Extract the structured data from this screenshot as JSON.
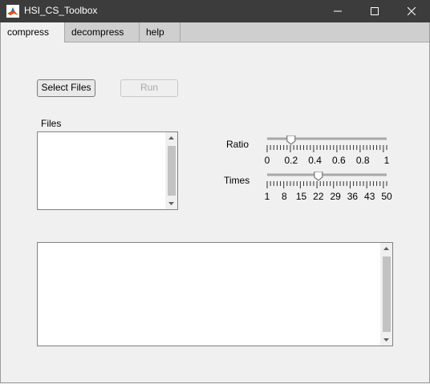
{
  "window": {
    "title": "HSI_CS_Toolbox",
    "controls": [
      "minimize-icon",
      "maximize-icon",
      "close-icon"
    ]
  },
  "tabs": [
    {
      "label": "compress",
      "active": true
    },
    {
      "label": "decompress",
      "active": false
    },
    {
      "label": "help",
      "active": false
    }
  ],
  "compress": {
    "select_files_label": "Select Files",
    "run_label": "Run",
    "run_enabled": false,
    "files_label": "Files",
    "files_list": [],
    "log_text": "",
    "ratio": {
      "label": "Ratio",
      "min": 0,
      "max": 1,
      "value": 0.2,
      "tick_labels": [
        "0",
        "0.2",
        "0.4",
        "0.6",
        "0.8",
        "1"
      ]
    },
    "times": {
      "label": "Times",
      "min": 1,
      "max": 50,
      "value": 22,
      "tick_labels": [
        "1",
        "8",
        "15",
        "22",
        "29",
        "36",
        "43",
        "50"
      ]
    }
  },
  "colors": {
    "titlebar": "#3c3c3c",
    "tabbar": "#cfcfcf",
    "panel": "#f0f0f0",
    "matlab_logo": "#d9531e"
  }
}
